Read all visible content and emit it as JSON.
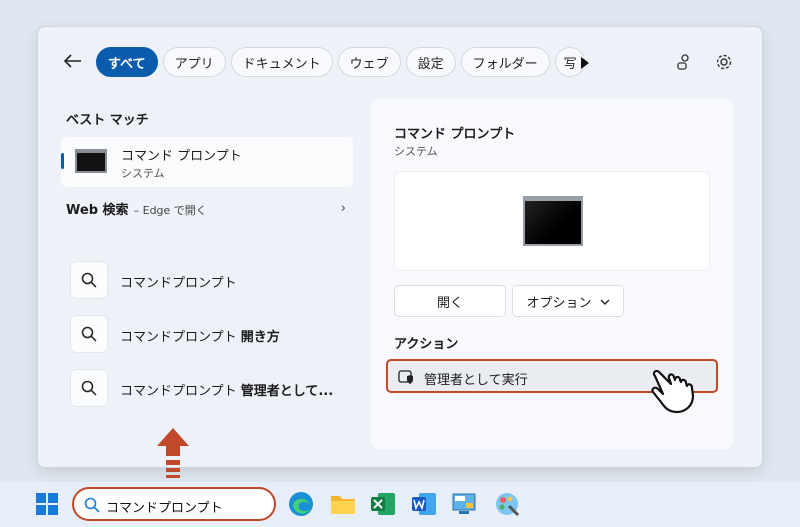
{
  "search_flyout": {
    "filter_tabs": [
      "すべて",
      "アプリ",
      "ドキュメント",
      "ウェブ",
      "設定",
      "フォルダー",
      "写"
    ],
    "active_tab_index": 0,
    "left": {
      "best_match_heading": "ベスト マッチ",
      "best_match": {
        "name": "コマンド プロンプト",
        "type": "システム"
      },
      "web_search": {
        "label": "Web 検索",
        "sub": "– Edge で開く"
      },
      "suggestions": [
        {
          "text": "コマンドプロンプト",
          "bold": ""
        },
        {
          "text": "コマンドプロンプト ",
          "bold": "開き方"
        },
        {
          "text": "コマンドプロンプト ",
          "bold": "管理者として..."
        }
      ]
    },
    "right": {
      "title": "コマンド プロンプト",
      "subtitle": "システム",
      "open_button": "開く",
      "options_button": "オプション",
      "actions_heading": "アクション",
      "run_as_admin": "管理者として実行"
    }
  },
  "taskbar": {
    "search_query": "コマンドプロンプト",
    "apps": [
      "edge-icon",
      "file-explorer-icon",
      "excel-icon",
      "word-icon",
      "control-panel-icon",
      "paint-icon"
    ]
  },
  "colors": {
    "accent": "#0b5cad",
    "highlight": "#c0482b"
  }
}
